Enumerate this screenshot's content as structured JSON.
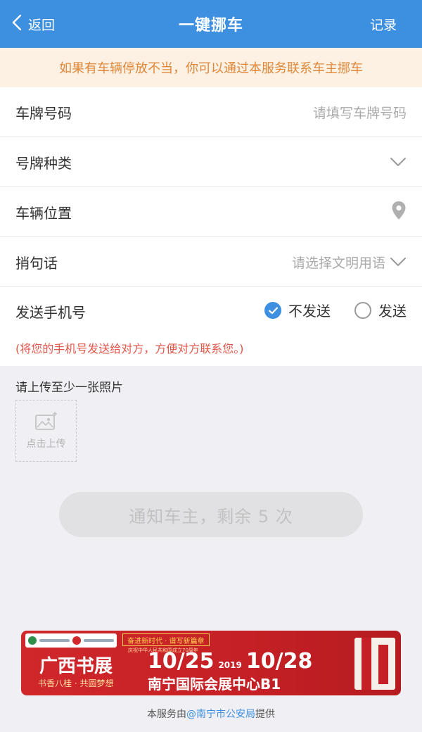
{
  "nav": {
    "back_label": "返回",
    "title": "一键挪车",
    "right_label": "记录"
  },
  "notice": "如果有车辆停放不当，你可以通过本服务联系车主挪车",
  "form": {
    "plate_number": {
      "label": "车牌号码",
      "placeholder": "请填写车牌号码"
    },
    "plate_type": {
      "label": "号牌种类"
    },
    "location": {
      "label": "车辆位置"
    },
    "message": {
      "label": "捎句话",
      "placeholder": "请选择文明用语"
    },
    "send_phone": {
      "label": "发送手机号",
      "options": [
        {
          "label": "不发送",
          "selected": true
        },
        {
          "label": "发送",
          "selected": false
        }
      ],
      "hint": "(将您的手机号发送给对方，方便对方联系您。)"
    }
  },
  "upload": {
    "title": "请上传至少一张照片",
    "button_label": "点击上传"
  },
  "notify_button": "通知车主，剩余 5 次",
  "banner": {
    "title": "广西书展",
    "subtitle": "书香八桂 · 共圆梦想",
    "slogan": "奋进新时代 · 谱写新篇章",
    "slogan_sub": "庆祝中华人民共和国成立70周年",
    "date_start": "10/25",
    "year": "2019",
    "date_end": "10/28",
    "venue": "南宁国际会展中心B1"
  },
  "footer": {
    "prefix": "本服务由",
    "provider": "@南宁市公安局",
    "suffix": "提供"
  },
  "colors": {
    "primary": "#3d8fe0",
    "notice_bg": "#fdf1e4",
    "notice_text": "#e0883a",
    "hint": "#e0574a",
    "banner_red": "#c42025"
  }
}
